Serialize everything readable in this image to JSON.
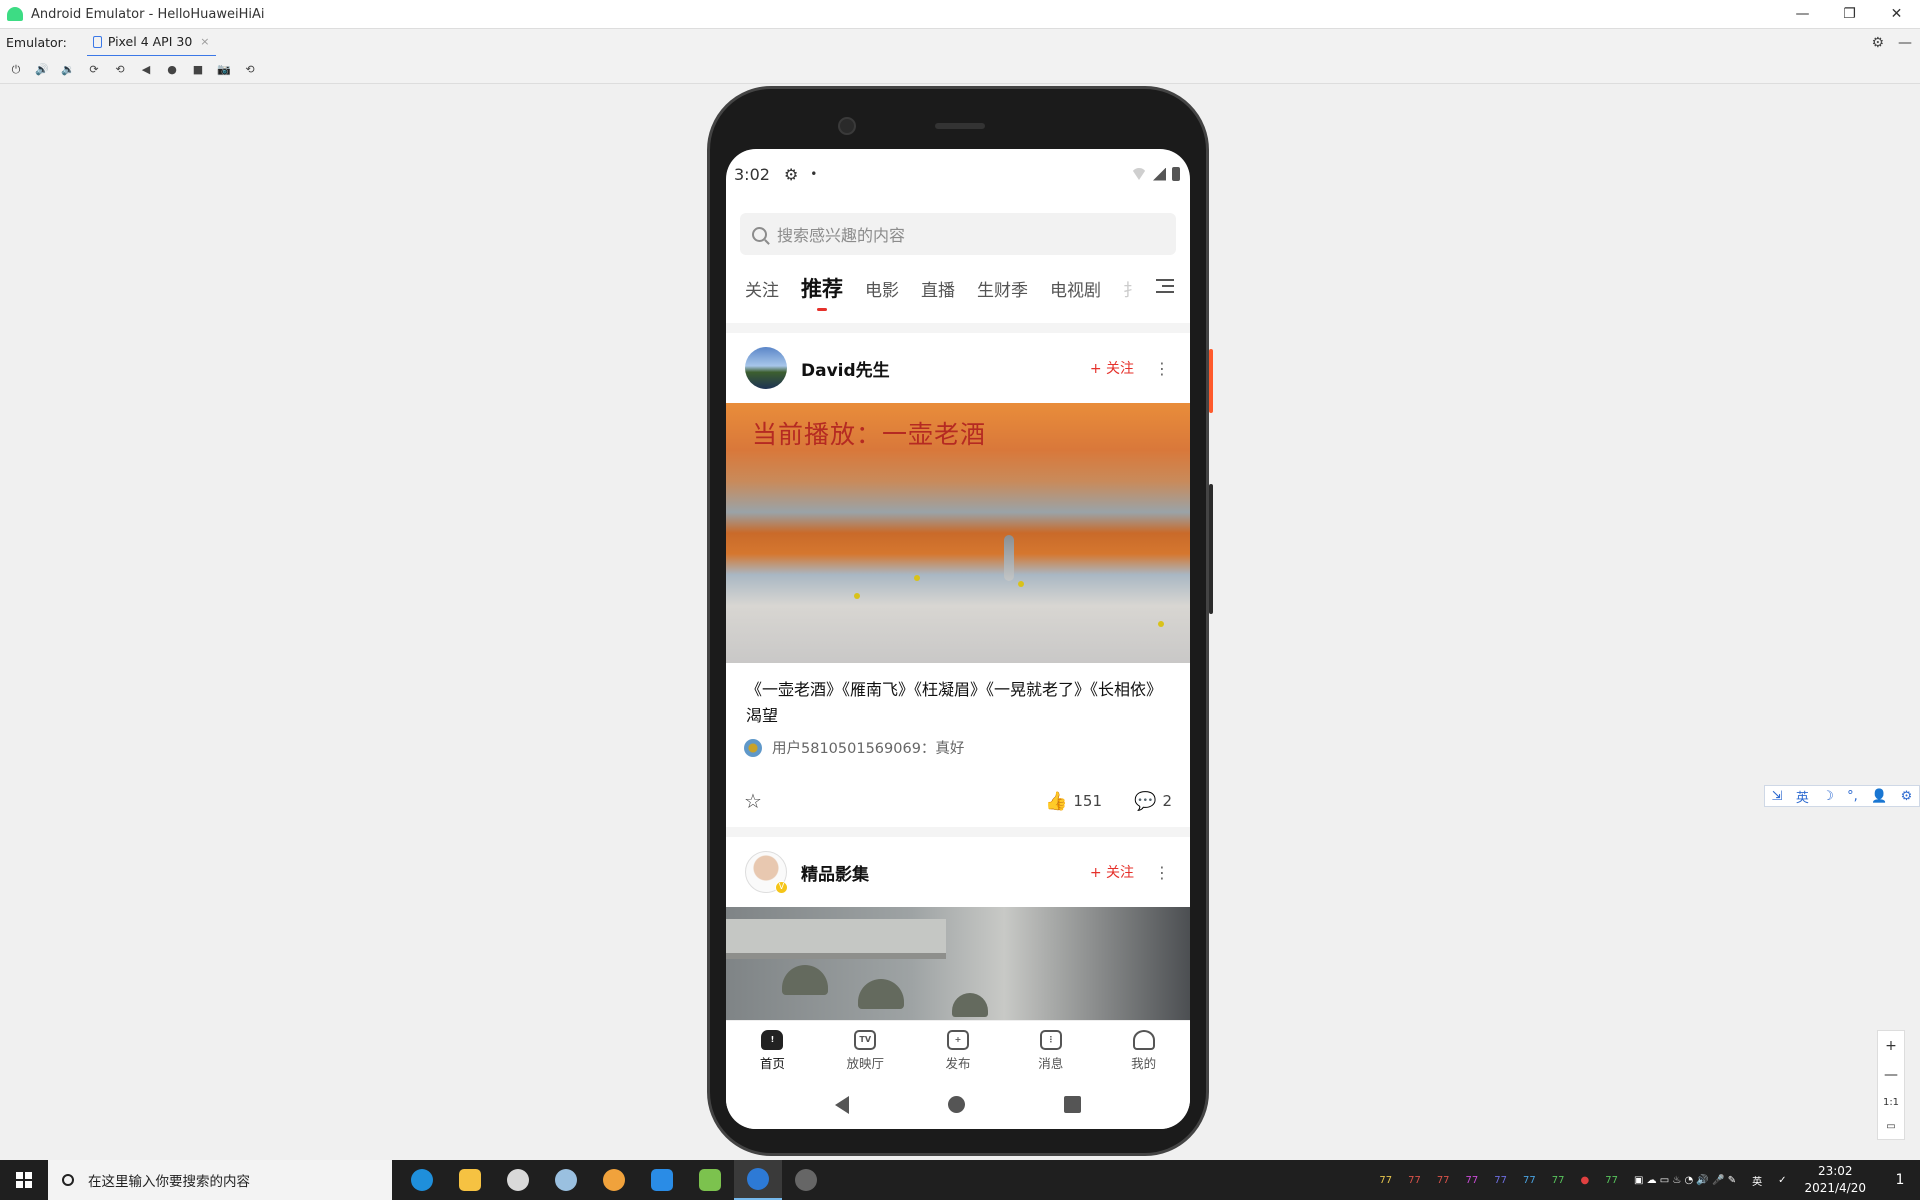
{
  "window": {
    "title": "Android Emulator - HelloHuaweiHiAi",
    "minimize": "—",
    "restore": "❐",
    "close": "✕"
  },
  "emulator": {
    "label": "Emulator:",
    "device_tab": "Pixel 4 API 30",
    "tab_close": "×",
    "settings_icon": "⚙",
    "collapse_icon": "—",
    "toolbar_icons": [
      "⏻",
      "🔊",
      "🔉",
      "⟳",
      "⟲",
      "◀",
      "●",
      "■",
      "📷",
      "⟲"
    ]
  },
  "phone": {
    "status": {
      "time": "3:02",
      "gear": "⚙",
      "dot": "•"
    },
    "search": {
      "placeholder": "搜索感兴趣的内容"
    },
    "channels": [
      "关注",
      "推荐",
      "电影",
      "直播",
      "生财季",
      "电视剧",
      "扌"
    ],
    "active_channel": "推荐",
    "posts": [
      {
        "author": "David先生",
        "follow": "+ 关注",
        "more": "⋮",
        "video_overlay": "当前播放：一壶老酒",
        "title": "《一壶老酒》《雁南飞》《枉凝眉》《一晃就老了》《长相依》渴望",
        "comment": "用户5810501569069：真好",
        "likes": "151",
        "comments": "2",
        "star": "☆",
        "like_icon": "👍",
        "comment_icon": "💬"
      },
      {
        "author": "精品影集",
        "follow": "+ 关注",
        "more": "⋮",
        "badge": "V"
      }
    ],
    "nav": [
      {
        "label": "首页",
        "icon": "!"
      },
      {
        "label": "放映厅",
        "icon": "TV"
      },
      {
        "label": "发布",
        "icon": "+"
      },
      {
        "label": "消息",
        "icon": "⋮"
      },
      {
        "label": "我的",
        "icon": ""
      }
    ]
  },
  "ime": [
    "⇲",
    "英",
    "☽",
    "°,",
    "👤",
    "⚙"
  ],
  "zoom": {
    "in": "+",
    "out": "—",
    "ratio": "1:1",
    "fit": "▭"
  },
  "taskbar": {
    "search_placeholder": "在这里输入你要搜索的内容",
    "tray_numbers": [
      "77",
      "77",
      "77",
      "77",
      "77",
      "77",
      "77",
      "77"
    ],
    "lang": "英",
    "time": "23:02",
    "date": "2021/4/20",
    "notification": "1"
  },
  "colors": {
    "accent_red": "#e5312b",
    "emulator_blue": "#3b78e7"
  }
}
